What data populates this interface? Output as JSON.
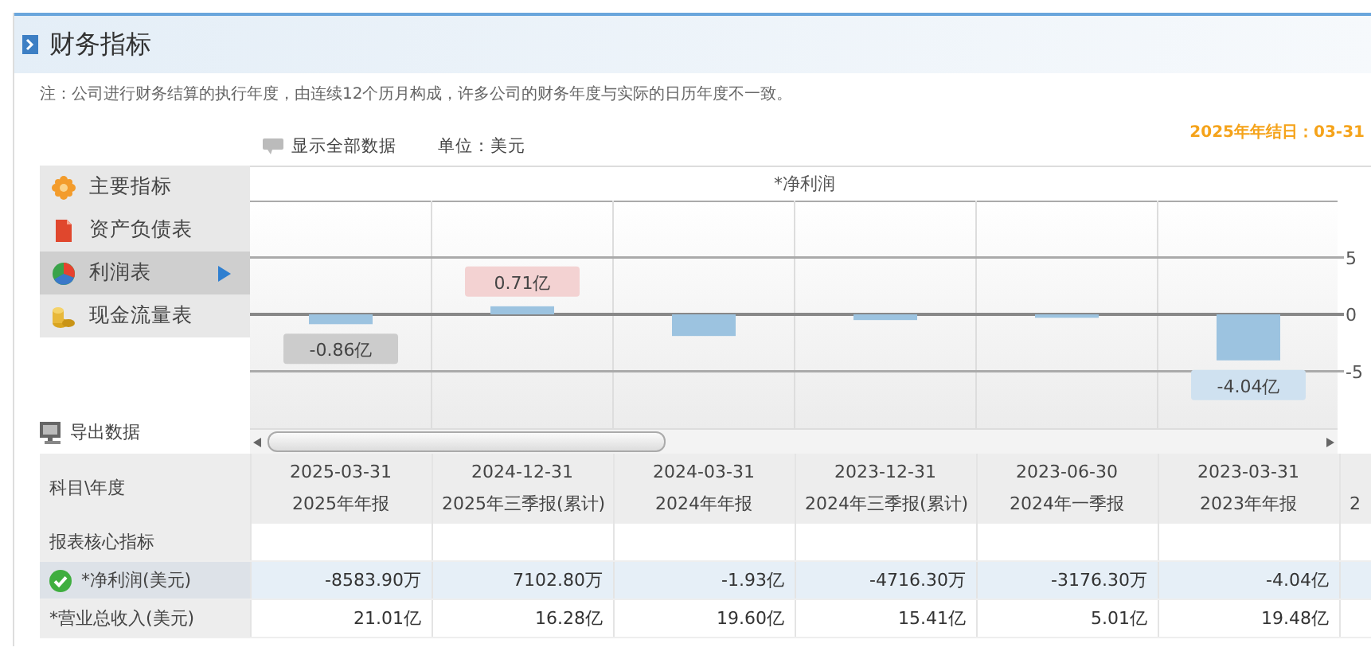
{
  "header": {
    "title": "财务指标"
  },
  "note": "注：公司进行财务结算的执行年度，由连续12个历月构成，许多公司的财务年度与实际的日历年度不一致。",
  "toolbar": {
    "show_all": "显示全部数据",
    "unit": "单位：美元",
    "fiscal_year_end": "2025年年结日：03-31"
  },
  "sidebar": {
    "items": [
      {
        "label": "主要指标",
        "kind": "flower",
        "selected": false
      },
      {
        "label": "资产负债表",
        "kind": "document",
        "selected": false
      },
      {
        "label": "利润表",
        "kind": "ball",
        "selected": true
      },
      {
        "label": "现金流量表",
        "kind": "coins",
        "selected": false
      }
    ],
    "export": "导出数据"
  },
  "chart": {
    "chart_data": {
      "type": "bar",
      "title": "*净利润",
      "values": [
        -0.86,
        0.71,
        -1.9,
        -0.5,
        -0.3,
        -4.04
      ],
      "ylim": [
        -10,
        10
      ],
      "yticks": [
        5,
        0,
        -5
      ],
      "value_labels": [
        "-0.86亿",
        "0.71亿",
        null,
        null,
        null,
        "-4.04亿"
      ]
    }
  },
  "table": {
    "header_label": "科目\\年度",
    "columns": [
      {
        "date": "2025-03-31",
        "period": "2025年年报"
      },
      {
        "date": "2024-12-31",
        "period": "2025年三季报(累计)"
      },
      {
        "date": "2024-03-31",
        "period": "2024年年报"
      },
      {
        "date": "2023-12-31",
        "period": "2024年三季报(累计)"
      },
      {
        "date": "2023-06-30",
        "period": "2024年一季报"
      },
      {
        "date": "2023-03-31",
        "period": "2023年年报"
      },
      {
        "period": "2"
      }
    ],
    "rows": [
      {
        "label": "报表核心指标",
        "selected": false
      },
      {
        "label": "*净利润(美元)",
        "selected": true,
        "cells": [
          "-8583.90万",
          "7102.80万",
          "-1.93亿",
          "-4716.30万",
          "-3176.30万",
          "-4.04亿"
        ]
      },
      {
        "label": "*营业总收入(美元)",
        "selected": false,
        "cells": [
          "21.01亿",
          "16.28亿",
          "19.60亿",
          "15.41亿",
          "5.01亿",
          "19.48亿"
        ]
      }
    ]
  }
}
